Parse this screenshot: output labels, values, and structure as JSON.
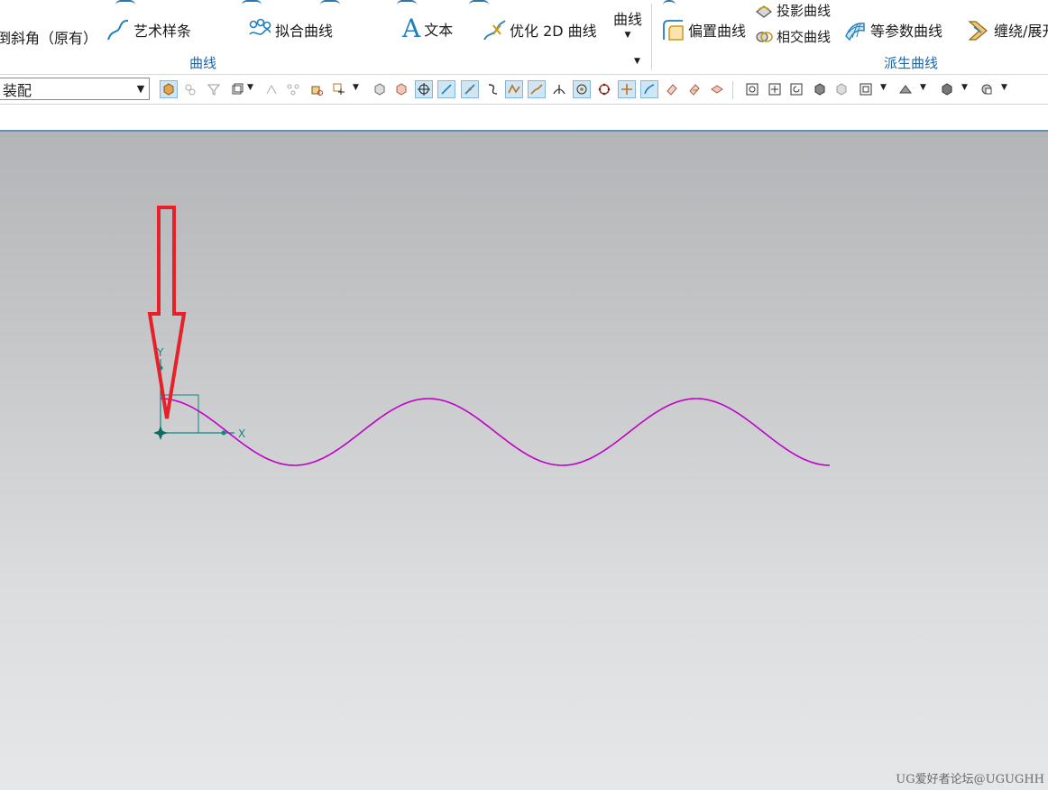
{
  "ribbon": {
    "curve_group": {
      "chamfer_label": "倒斜角（原有）",
      "studio_spline_label": "艺术样条",
      "fit_curve_label": "拟合曲线",
      "text_label": "文本",
      "optimize_2d_label": "优化 2D 曲线",
      "more_label": "曲线",
      "group_title": "曲线"
    },
    "derived_group": {
      "offset_curve_label": "偏置曲线",
      "project_curve_label": "投影曲线",
      "intersection_curve_label": "相交曲线",
      "isoparametric_label": "等参数曲线",
      "wrap_unwrap_label": "缠绕/展开",
      "group_title": "派生曲线"
    }
  },
  "toolbar": {
    "assembly_filter_value": "装配"
  },
  "viewport": {
    "axis_x_label": "X",
    "axis_y_label": "Y",
    "curve_color": "#c000c8",
    "axis_color": "#0a8a82",
    "annotation_arrow_color": "#e8202a"
  },
  "watermark": "UG爱好者论坛@UGUGHH",
  "colors": {
    "accent": "#1f66a6",
    "toolbar_active": "#cfe6f5"
  }
}
